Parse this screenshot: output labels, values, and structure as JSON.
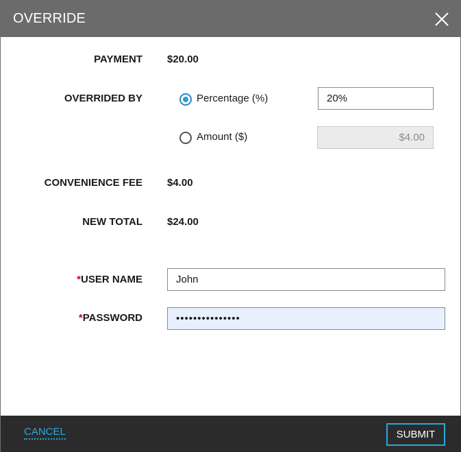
{
  "dialog": {
    "title": "OVERRIDE",
    "close_icon": "close-icon"
  },
  "payment": {
    "label": "PAYMENT",
    "value": "$20.00"
  },
  "overrided_by": {
    "label": "OVERRIDED BY",
    "options": [
      {
        "label": "Percentage (%)",
        "checked": true,
        "value": "20%"
      },
      {
        "label": "Amount ($)",
        "checked": false,
        "value": "$4.00"
      }
    ]
  },
  "convenience_fee": {
    "label": "CONVENIENCE FEE",
    "value": "$4.00"
  },
  "new_total": {
    "label": "NEW TOTAL",
    "value": "$24.00"
  },
  "user_name": {
    "required_mark": "*",
    "label": "USER NAME",
    "value": "John"
  },
  "password": {
    "required_mark": "*",
    "label": "PASSWORD",
    "value": "•••••••••••••••"
  },
  "footer": {
    "cancel_label": "CANCEL",
    "submit_label": "SUBMIT"
  },
  "colors": {
    "header_bg": "#6b6b6b",
    "footer_bg": "#2b2b2b",
    "accent": "#2aa7e0",
    "required": "#d0021b"
  }
}
